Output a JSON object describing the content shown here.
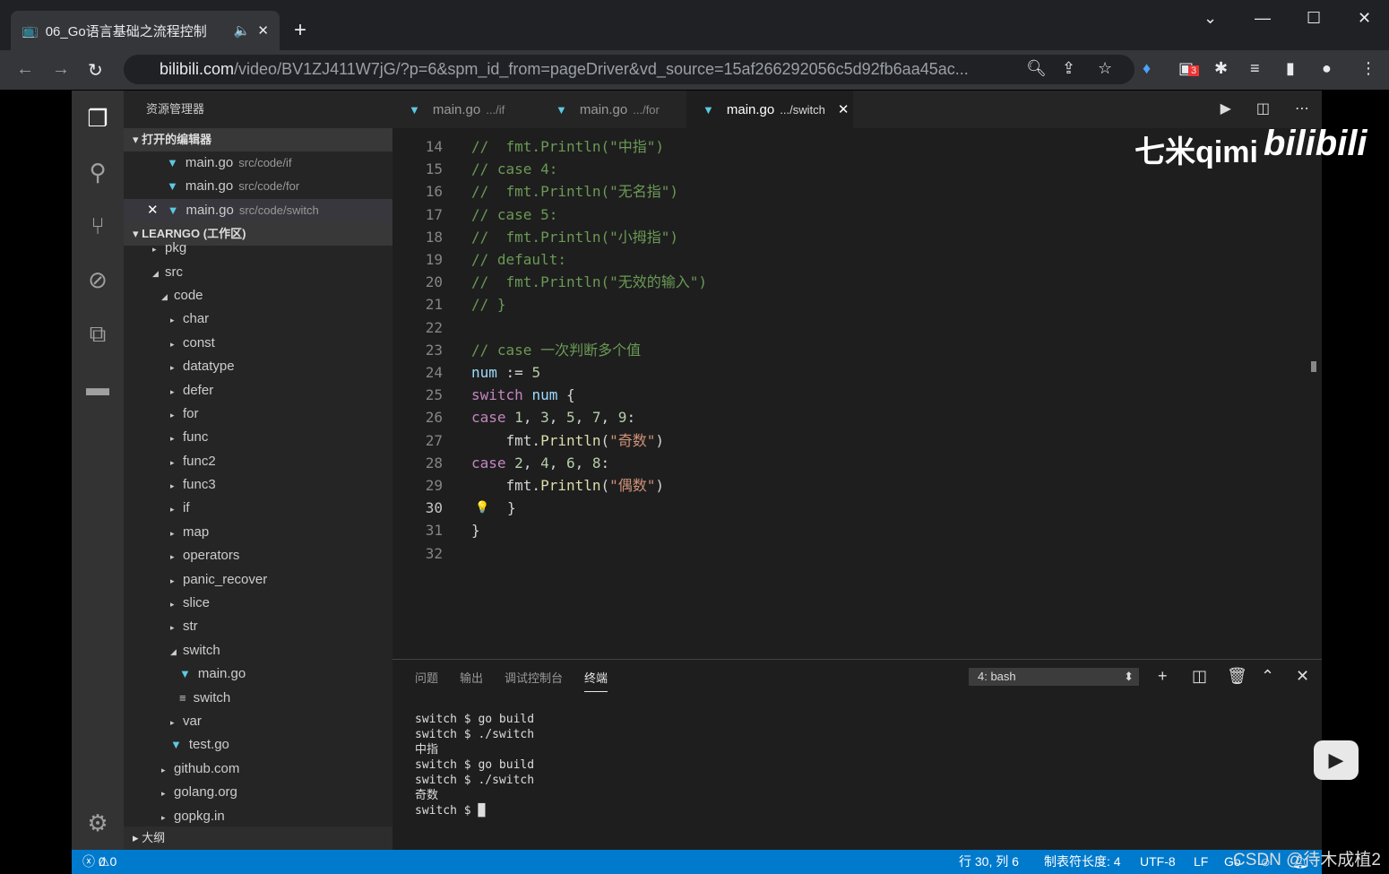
{
  "browser": {
    "tab_title": "06_Go语言基础之流程控制",
    "url_domain": "bilibili.com",
    "url_path": "/video/BV1ZJ411W7jG/?p=6&spm_id_from=pageDriver&vd_source=15af266292056c5d92fb6aa45ac...",
    "ext_badge": "3"
  },
  "sidebar": {
    "title": "资源管理器",
    "open_editors_label": "打开的编辑器",
    "open_editors": [
      {
        "name": "main.go",
        "path": "src/code/if"
      },
      {
        "name": "main.go",
        "path": "src/code/for"
      },
      {
        "name": "main.go",
        "path": "src/code/switch"
      }
    ],
    "workspace_label": "LEARNGO (工作区)",
    "tree": [
      "pkg",
      "src",
      "code",
      "char",
      "const",
      "datatype",
      "defer",
      "for",
      "func",
      "func2",
      "func3",
      "if",
      "map",
      "operators",
      "panic_recover",
      "slice",
      "str",
      "switch",
      "main.go",
      "switch",
      "var",
      "test.go",
      "github.com",
      "golang.org",
      "gopkg.in"
    ],
    "outline_label": "大纲"
  },
  "editor": {
    "tabs": [
      {
        "name": "main.go",
        "path": ".../if"
      },
      {
        "name": "main.go",
        "path": ".../for"
      },
      {
        "name": "main.go",
        "path": ".../switch"
      }
    ],
    "line_numbers": [
      "14",
      "15",
      "16",
      "17",
      "18",
      "19",
      "20",
      "21",
      "22",
      "23",
      "24",
      "25",
      "26",
      "27",
      "28",
      "29",
      "30",
      "31",
      "32"
    ],
    "current_line": "30"
  },
  "panel": {
    "tabs": [
      "问题",
      "输出",
      "调试控制台",
      "终端"
    ],
    "active_tab": "终端",
    "terminal_select": "4: bash",
    "terminal_lines": [
      "switch $ go build",
      "switch $ ./switch",
      "中指",
      "switch $ go build",
      "switch $ ./switch",
      "奇数",
      "switch $ "
    ]
  },
  "status": {
    "errors": "0",
    "warnings": "0",
    "position": "行 30, 列 6",
    "tab_size": "制表符长度: 4",
    "encoding": "UTF-8",
    "eol": "LF",
    "lang": "Go"
  },
  "watermarks": {
    "uploader": "七米qimi",
    "site": "bilibili",
    "csdn": "CSDN @待木成植2"
  }
}
